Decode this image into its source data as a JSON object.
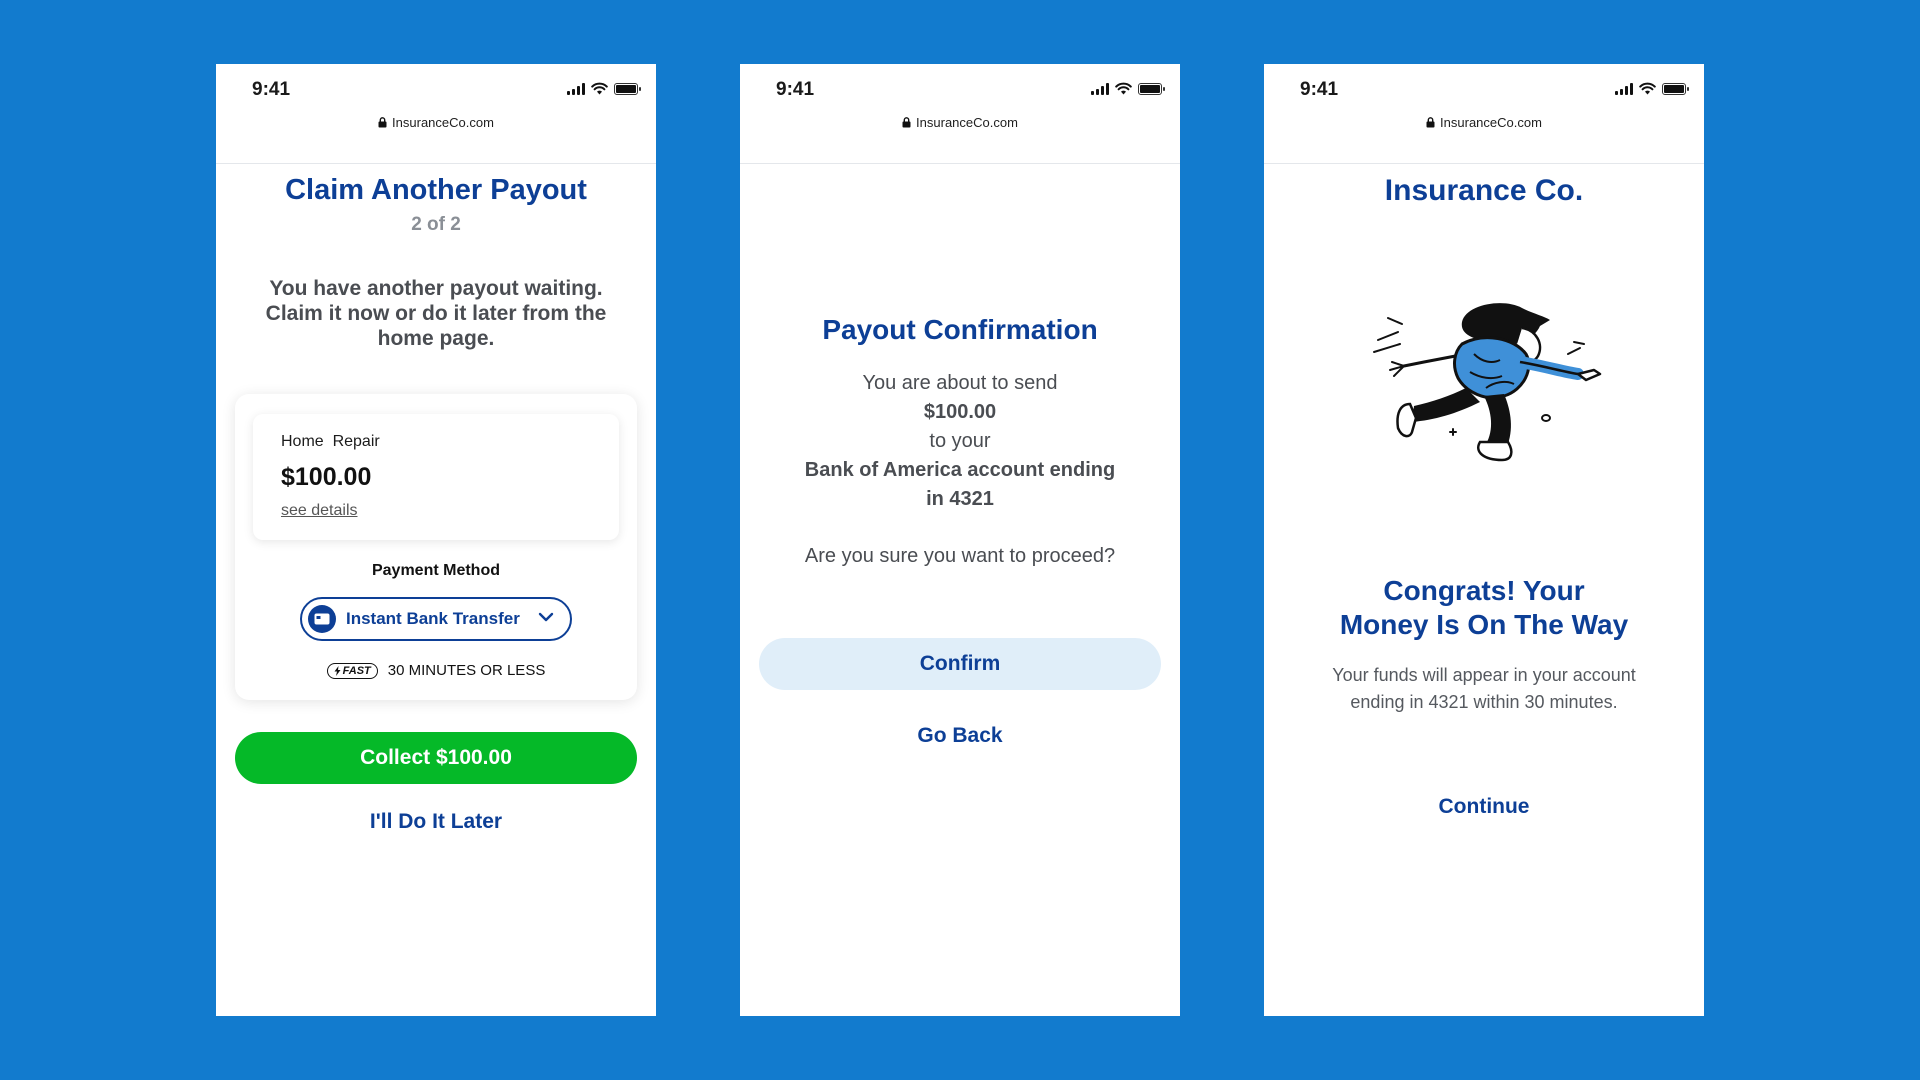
{
  "screens": [
    {
      "status_time": "9:41",
      "url": "InsuranceCo.com",
      "title": "Claim Another Payout",
      "step": "2 of 2",
      "message": "You have another payout waiting. Claim it now or do it later from the home page.",
      "claim": {
        "category": "Home  Repair",
        "amount": "$100.00",
        "details_link": "see details"
      },
      "payment_method_label": "Payment Method",
      "payment_method_value": "Instant Bank Transfer",
      "speed_badge": "FAST",
      "speed_text": "30 MINUTES OR LESS",
      "primary_button": "Collect $100.00",
      "secondary_link": "I'll Do It Later"
    },
    {
      "status_time": "9:41",
      "url": "InsuranceCo.com",
      "title": "Payout Confirmation",
      "lines": [
        "You are about to send",
        "$100.00",
        "to your",
        "Bank of America account ending",
        "in 4321"
      ],
      "question": "Are you sure you want to proceed?",
      "primary_button": "Confirm",
      "secondary_link": "Go Back"
    },
    {
      "status_time": "9:41",
      "url": "InsuranceCo.com",
      "brand": "Insurance Co.",
      "heading_lines": [
        "Congrats! Your",
        "Money Is On The Way"
      ],
      "body_lines": [
        "Your funds will appear in your account",
        "ending in 4321 within 30 minutes."
      ],
      "primary_link": "Continue"
    }
  ],
  "colors": {
    "background": "#127bce",
    "brand_blue": "#0d3f96",
    "success_green": "#05b928",
    "confirm_button_bg": "#e0eef9"
  },
  "icons": [
    "signal-icon",
    "wifi-icon",
    "battery-icon",
    "lock-icon",
    "bank-card-icon",
    "chevron-down-icon",
    "lightning-icon"
  ]
}
